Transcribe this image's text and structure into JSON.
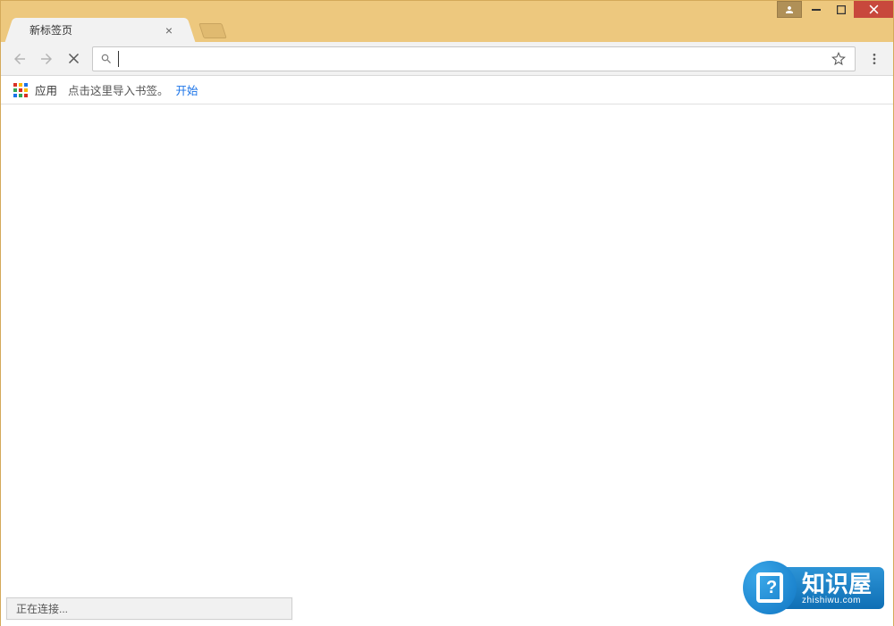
{
  "window": {
    "profile_icon": "person",
    "minimize": "—",
    "maximize": "□",
    "close": "✕"
  },
  "tab": {
    "title": "新标签页",
    "close": "×"
  },
  "toolbar": {
    "omnibox_value": "",
    "omnibox_placeholder": ""
  },
  "bookmarkbar": {
    "apps_label": "应用",
    "hint_text": "点击这里导入书签。",
    "start_link": "开始"
  },
  "status": {
    "text": "正在连接..."
  },
  "watermark": {
    "title": "知识屋",
    "sub": "zhishiwu.com"
  }
}
